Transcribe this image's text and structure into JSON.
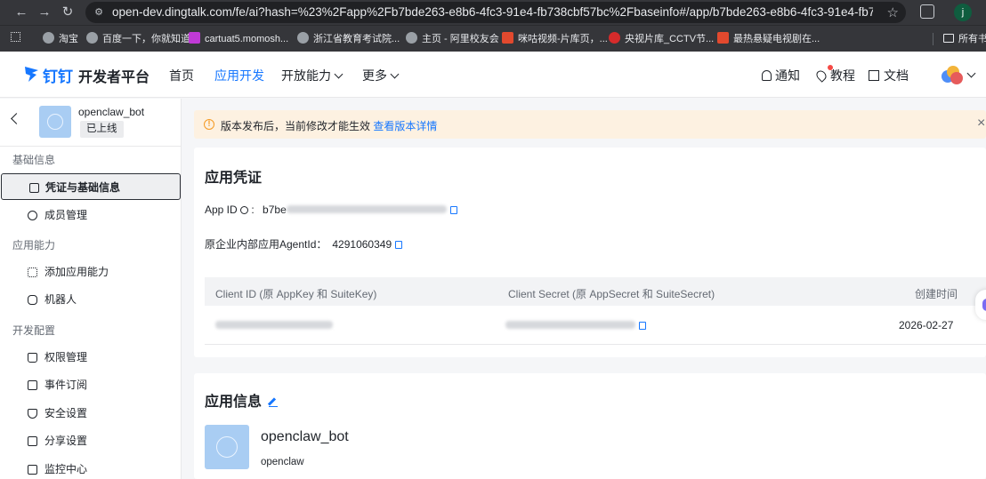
{
  "browser": {
    "url": "open-dev.dingtalk.com/fe/ai?hash=%23%2Fapp%2Fb7bde263-e8b6-4fc3-91e4-fb738cbf57bc%2Fbaseinfo#/app/b7bde263-e8b6-4fc3-91e4-fb738cbf57bc/base...",
    "profile_letter": "j",
    "bookmarks": [
      "淘宝",
      "百度一下，你就知道",
      "cartuat5.momosh...",
      "浙江省教育考试院...",
      "主页 - 阿里校友会",
      "咪咕视频-片库页，...",
      "央视片库_CCTV节...",
      "最热悬疑电视剧在..."
    ],
    "bookmarks_more": "所有书"
  },
  "header": {
    "logo_mark": "钉钉",
    "logo_text": "开发者平台",
    "nav": [
      {
        "label": "首页"
      },
      {
        "label": "应用开发"
      },
      {
        "label": "开放能力"
      },
      {
        "label": "更多"
      }
    ],
    "notify": "通知",
    "tutorial": "教程",
    "docs": "文档"
  },
  "sidebar": {
    "app_name": "openclaw_bot",
    "status": "已上线",
    "groups": [
      {
        "label": "基础信息",
        "items": [
          {
            "label": "凭证与基础信息"
          },
          {
            "label": "成员管理"
          }
        ]
      },
      {
        "label": "应用能力",
        "items": [
          {
            "label": "添加应用能力"
          },
          {
            "label": "机器人"
          }
        ]
      },
      {
        "label": "开发配置",
        "items": [
          {
            "label": "权限管理"
          },
          {
            "label": "事件订阅"
          },
          {
            "label": "安全设置"
          },
          {
            "label": "分享设置"
          },
          {
            "label": "监控中心"
          }
        ]
      }
    ]
  },
  "alert": {
    "text": "版本发布后，当前修改才能生效",
    "link": "查看版本详情"
  },
  "credentials": {
    "title": "应用凭证",
    "app_id_label": "App ID",
    "app_id_prefix": "b7be",
    "agent_id_label": "原企业内部应用AgentId：",
    "agent_id": "4291060349",
    "columns": [
      "Client ID (原 AppKey 和 SuiteKey)",
      "Client Secret (原 AppSecret 和 SuiteSecret)",
      "创建时间"
    ],
    "created": "2026-02-27"
  },
  "app_info": {
    "title": "应用信息",
    "name": "openclaw_bot",
    "description": "openclaw"
  },
  "colors": {
    "accent": "#1677ff",
    "warning_bg": "#fdf1e1",
    "warning_icon": "#f59a23"
  }
}
